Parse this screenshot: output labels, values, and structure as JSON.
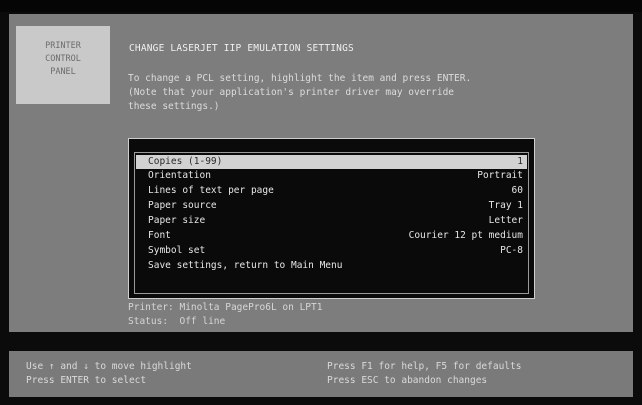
{
  "logo": [
    "PRINTER",
    "CONTROL",
    "PANEL"
  ],
  "title": "CHANGE LASERJET IIP EMULATION SETTINGS",
  "instructions": [
    "To change a PCL setting, highlight the item and press ENTER.",
    "(Note that your application's printer driver may override",
    "these settings.)"
  ],
  "menu": [
    {
      "label": "Copies (1-99)",
      "value": "1",
      "selected": true
    },
    {
      "label": "Orientation",
      "value": "Portrait"
    },
    {
      "label": "Lines of text per page",
      "value": "60"
    },
    {
      "label": "Paper source",
      "value": "Tray 1"
    },
    {
      "label": "Paper size",
      "value": "Letter"
    },
    {
      "label": "Font",
      "value": "Courier 12 pt medium"
    },
    {
      "label": "Symbol set",
      "value": "PC-8"
    },
    {
      "label": "Save settings, return to Main Menu",
      "value": ""
    }
  ],
  "status": {
    "printer": "Printer: Minolta PagePro6L on LPT1",
    "state": "Status:  Off line"
  },
  "footer": {
    "left1": "Use ↑ and ↓ to move highlight",
    "left2": "Press ENTER to select",
    "right1": "Press F1 for help, F5 for defaults",
    "right2": "Press ESC to abandon changes"
  }
}
